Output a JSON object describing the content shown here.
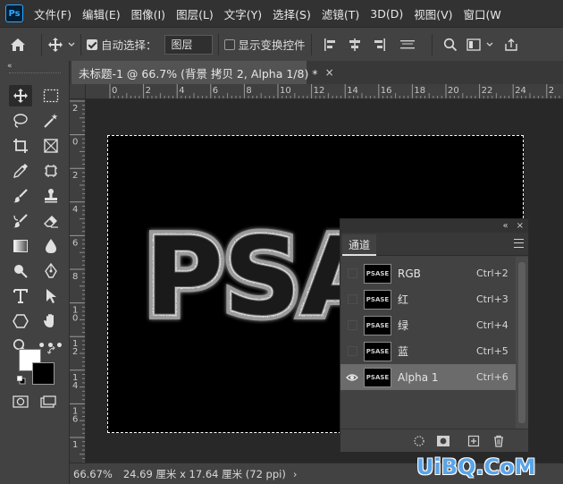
{
  "app": {
    "logo_text": "Ps"
  },
  "menu": [
    "文件(F)",
    "编辑(E)",
    "图像(I)",
    "图层(L)",
    "文字(Y)",
    "选择(S)",
    "滤镜(T)",
    "3D(D)",
    "视图(V)",
    "窗口(W"
  ],
  "options": {
    "auto_select_label": "自动选择：",
    "auto_select_checked": true,
    "auto_select_target": "图层",
    "show_transform_label": "显示变换控件",
    "show_transform_checked": false
  },
  "document": {
    "tab_title": "未标题-1 @ 66.7% (背景 拷贝 2, Alpha 1/8) *",
    "close_glyph": "×",
    "canvas_text": "PSA",
    "ruler_top_labels": [
      "0",
      "2",
      "4",
      "6",
      "8",
      "10",
      "12",
      "14",
      "16",
      "18",
      "20",
      "22",
      "24",
      "2"
    ],
    "ruler_left_labels": [
      "2",
      "0",
      "2",
      "4",
      "6",
      "8",
      "10",
      "12",
      "14",
      "16",
      "1"
    ]
  },
  "status": {
    "zoom": "66.67%",
    "info": "24.69 厘米 x 17.64 厘米 (72 ppi)",
    "arrow": "›"
  },
  "channels_panel": {
    "header_collapse": "«",
    "header_close": "×",
    "tab_label": "通道",
    "thumb_text": "PSASE",
    "channels": [
      {
        "name": "RGB",
        "shortcut": "Ctrl+2",
        "visible": false,
        "selected": false
      },
      {
        "name": "红",
        "shortcut": "Ctrl+3",
        "visible": false,
        "selected": false
      },
      {
        "name": "绿",
        "shortcut": "Ctrl+4",
        "visible": false,
        "selected": false
      },
      {
        "name": "蓝",
        "shortcut": "Ctrl+5",
        "visible": false,
        "selected": false
      },
      {
        "name": "Alpha 1",
        "shortcut": "Ctrl+6",
        "visible": true,
        "selected": true
      }
    ]
  },
  "colors": {
    "foreground": "#ffffff",
    "background": "#000000"
  },
  "watermark": "UiBQ.CoM"
}
